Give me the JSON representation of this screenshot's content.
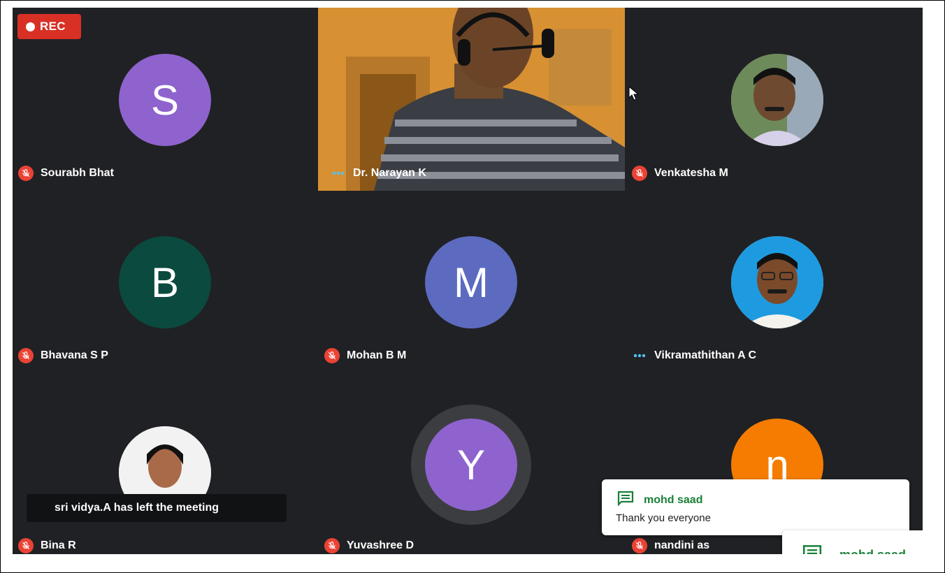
{
  "recording": {
    "label": "REC"
  },
  "participants": [
    {
      "name": "Sourabh Bhat",
      "initial": "S",
      "color": "#8e63ce"
    },
    {
      "name": "Dr. Narayan K"
    },
    {
      "name": "Venkatesha M"
    },
    {
      "name": "Bhavana S P",
      "initial": "B",
      "color": "#0b4a3e"
    },
    {
      "name": "Mohan B M",
      "initial": "M",
      "color": "#5c6bc0"
    },
    {
      "name": "Vikramathithan A C"
    },
    {
      "name": "Bina R"
    },
    {
      "name": "Yuvashree D",
      "initial": "Y",
      "color": "#8e63ce"
    },
    {
      "name": "nandini as",
      "initial": "n",
      "color": "#f57c00"
    }
  ],
  "notification": {
    "text": "sri vidya.A has left the meeting"
  },
  "chat": {
    "sender": "mohd saad",
    "message": "Thank you everyone",
    "sender_partial": "mohd saad"
  },
  "colors": {
    "mic_off": "#ea4335",
    "talking": "#4fc3f7",
    "rec": "#d93025"
  }
}
